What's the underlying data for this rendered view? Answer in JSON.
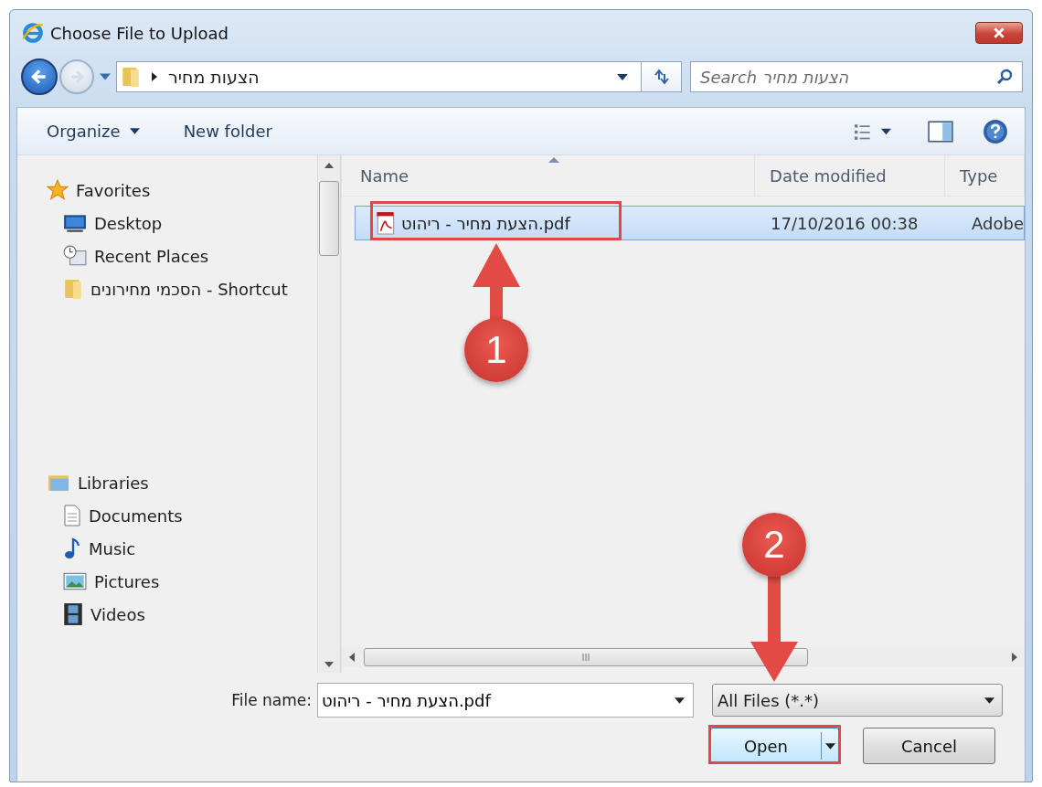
{
  "window": {
    "title": "Choose File to Upload"
  },
  "address_bar": {
    "path": "הצעות מחיר"
  },
  "search": {
    "placeholder": "Search הצעות מחיר"
  },
  "toolbar": [
    {
      "label": "Organize",
      "kind": "menu"
    },
    {
      "label": "New folder",
      "kind": "plain"
    }
  ],
  "navigation": [
    {
      "label": "Favorites",
      "kind": "star",
      "children": [
        {
          "label": "Desktop",
          "kind": "desktop"
        },
        {
          "label": "Recent Places",
          "kind": "recent"
        },
        {
          "label": "הסכמי מחירונים - Shortcut",
          "kind": "folder"
        }
      ]
    },
    {
      "label": "Libraries",
      "kind": "library",
      "children": [
        {
          "label": "Documents",
          "kind": "documents"
        },
        {
          "label": "Music",
          "kind": "music"
        },
        {
          "label": "Pictures",
          "kind": "pictures"
        },
        {
          "label": "Videos",
          "kind": "videos"
        }
      ]
    }
  ],
  "columns": [
    {
      "label": "Name",
      "sorted": true
    },
    {
      "label": "Date modified",
      "sorted": false
    },
    {
      "label": "Type",
      "sorted": false
    }
  ],
  "files": [
    {
      "name": "הצעת מחיר - ריהוט.pdf",
      "date": "17/10/2016 00:38",
      "type": "Adobe",
      "selected": true
    }
  ],
  "file_name": {
    "label": "File name:",
    "value": "הצעת מחיר - ריהוט.pdf"
  },
  "file_type": {
    "value": "All Files (*.*)"
  },
  "buttons": [
    {
      "label": "Open",
      "kind": "split"
    },
    {
      "label": "Cancel",
      "kind": "plain"
    }
  ],
  "annotations": [
    {
      "label": "1"
    },
    {
      "label": "2"
    }
  ]
}
